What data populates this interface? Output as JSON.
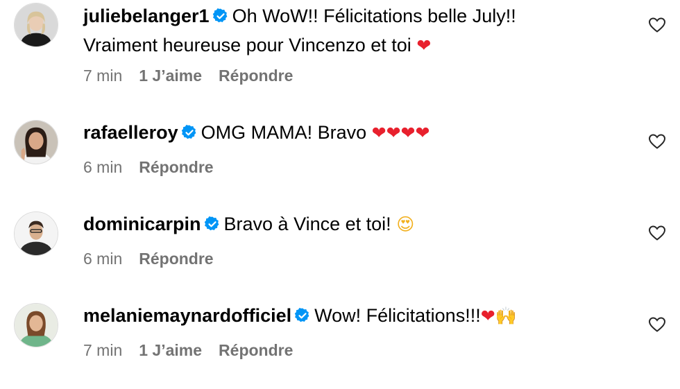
{
  "comments": [
    {
      "username": "juliebelanger1",
      "verified": true,
      "text_line1": "Oh WoW!! Félicitations belle July!!",
      "text_line2": "Vraiment heureuse pour Vincenzo et toi",
      "emoji": "❤",
      "time": "7 min",
      "likes": "1 J’aime",
      "reply": "Répondre",
      "avatar_icon": "avatar-photo-icon",
      "like_icon": "heart-outline-icon"
    },
    {
      "username": "rafaelleroy",
      "verified": true,
      "text": "OMG MAMA! Bravo",
      "emoji": "❤❤❤❤",
      "time": "6 min",
      "reply": "Répondre",
      "avatar_icon": "avatar-photo-icon",
      "like_icon": "heart-outline-icon"
    },
    {
      "username": "dominicarpin",
      "verified": true,
      "text": "Bravo à Vince et toi!",
      "emoji": "😍",
      "time": "6 min",
      "reply": "Répondre",
      "avatar_icon": "avatar-photo-icon",
      "like_icon": "heart-outline-icon"
    },
    {
      "username": "melaniemaynardofficiel",
      "verified": true,
      "text": "Wow! Félicitations!!!",
      "emoji": "❤🙌",
      "time": "7 min",
      "likes": "1 J’aime",
      "reply": "Répondre",
      "avatar_icon": "avatar-photo-icon",
      "like_icon": "heart-outline-icon"
    }
  ],
  "colors": {
    "verified_blue": "#0095f6",
    "meta_gray": "#737373",
    "heart_red": "#e8202d"
  }
}
